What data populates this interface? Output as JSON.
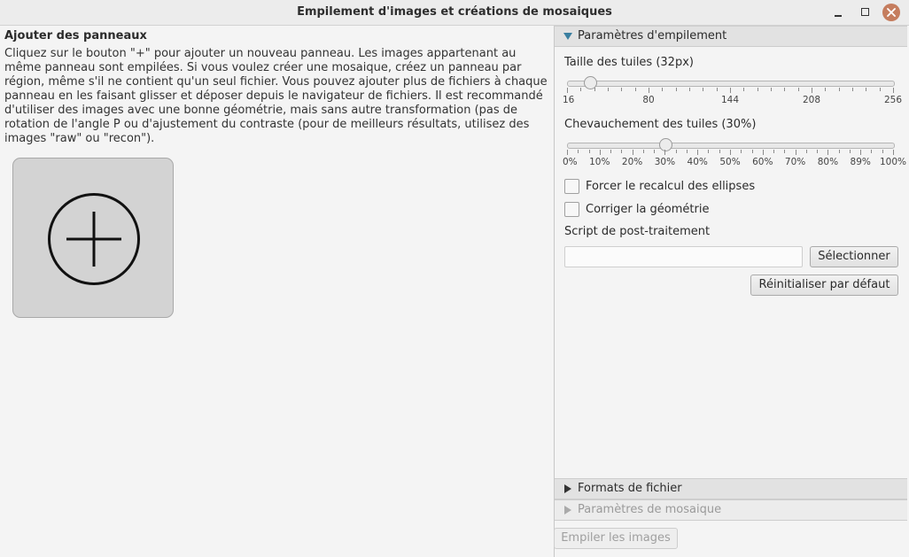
{
  "window": {
    "title": "Empilement d'images et créations de mosaiques"
  },
  "left": {
    "heading": "Ajouter des panneaux",
    "help": "Cliquez sur le bouton \"+\" pour ajouter un nouveau panneau. Les images appartenant au même panneau sont empilées. Si vous voulez créer une mosaique, créez un panneau par région, même s'il ne contient qu'un seul fichier. Vous pouvez ajouter plus de fichiers à chaque panneau en les faisant glisser et déposer depuis le navigateur de fichiers. Il est recommandé d'utiliser des images avec une bonne géométrie, mais sans autre transformation (pas de rotation de l'angle P ou d'ajustement du contraste (pour de meilleurs résultats, utilisez des images \"raw\" ou \"recon\").",
    "add_panel_icon": "plus-circle-icon"
  },
  "stacking": {
    "header": "Paramètres d'empilement",
    "expanded": true,
    "tile_size": {
      "label": "Taille des tuiles (32px)",
      "value": 32,
      "min": 16,
      "max": 256,
      "tick_labels": [
        "16",
        "80",
        "144",
        "208",
        "256"
      ]
    },
    "tile_overlap": {
      "label": "Chevauchement des tuiles (30%)",
      "value": 30,
      "min": 0,
      "max": 100,
      "tick_labels": [
        "0%",
        "10%",
        "20%",
        "30%",
        "40%",
        "50%",
        "60%",
        "70%",
        "80%",
        "89%",
        "100%"
      ]
    },
    "force_ellipse": {
      "label": "Forcer le recalcul des ellipses",
      "checked": false
    },
    "fix_geometry": {
      "label": "Corriger la géométrie",
      "checked": false
    },
    "post_script": {
      "label": "Script de post-traitement",
      "value": ""
    },
    "select_button": "Sélectionner",
    "reset_button": "Réinitialiser par défaut"
  },
  "file_formats": {
    "header": "Formats de fichier"
  },
  "mosaic": {
    "header": "Paramètres de mosaique",
    "disabled": true
  },
  "stack_button": {
    "label": "Empiler les images",
    "disabled": true
  },
  "colors": {
    "accent_triangle": "#3a7fa0",
    "close_button": "#c57d5e"
  }
}
